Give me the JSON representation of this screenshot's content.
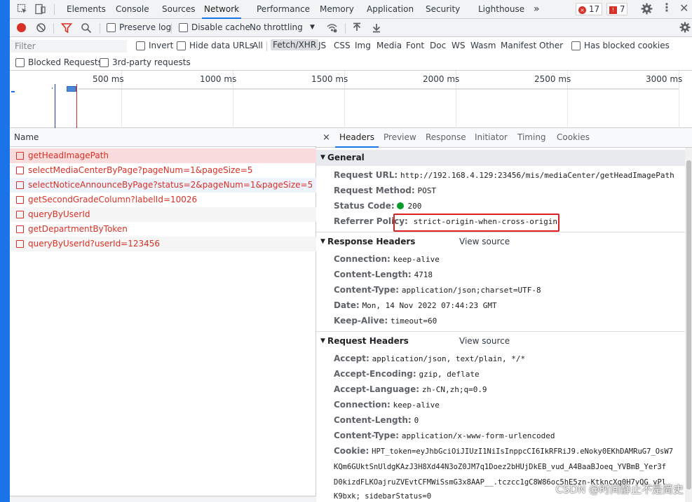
{
  "topbar": {
    "tabs": [
      "Elements",
      "Console",
      "Sources",
      "Network",
      "Performance",
      "Memory",
      "Application",
      "Security",
      "Lighthouse"
    ],
    "more": "»",
    "errors": "17",
    "warnings": "7"
  },
  "toolbar": {
    "preserve_log": "Preserve log",
    "disable_cache": "Disable cache",
    "throttling": "No throttling"
  },
  "filter": {
    "placeholder": "Filter",
    "invert": "Invert",
    "hide_data_urls": "Hide data URLs",
    "types": [
      "All",
      "Fetch/XHR",
      "JS",
      "CSS",
      "Img",
      "Media",
      "Font",
      "Doc",
      "WS",
      "Wasm",
      "Manifest",
      "Other"
    ],
    "selected_type": "Fetch/XHR",
    "has_blocked_cookies": "Has blocked cookies",
    "blocked_requests": "Blocked Requests",
    "third_party": "3rd-party requests"
  },
  "timeline": {
    "ticks": [
      "500 ms",
      "1000 ms",
      "1500 ms",
      "2000 ms",
      "2500 ms",
      "3000 ms"
    ]
  },
  "requests": {
    "header": "Name",
    "items": [
      "getHeadImagePath",
      "selectMediaCenterByPage?pageNum=1&pageSize=5",
      "selectNoticeAnnounceByPage?status=2&pageNum=1&pageSize=5",
      "getSecondGradeColumn?labelId=10026",
      "queryByUserId",
      "getDepartmentByToken",
      "queryByUserId?userId=123456"
    ]
  },
  "details": {
    "close": "×",
    "tabs": [
      "Headers",
      "Preview",
      "Response",
      "Initiator",
      "Timing",
      "Cookies"
    ],
    "general": {
      "title": "General",
      "request_url_k": "Request URL:",
      "request_url_v": "http://192.168.4.129:23456/mis/mediaCenter/getHeadImagePath",
      "method_k": "Request Method:",
      "method_v": "POST",
      "status_k": "Status Code:",
      "status_v": "200",
      "referrer_k": "Referrer Policy:",
      "referrer_v": "strict-origin-when-cross-origin"
    },
    "response_headers": {
      "title": "Response Headers",
      "view_source": "View source",
      "rows": [
        {
          "k": "Connection:",
          "v": "keep-alive"
        },
        {
          "k": "Content-Length:",
          "v": "4718"
        },
        {
          "k": "Content-Type:",
          "v": "application/json;charset=UTF-8"
        },
        {
          "k": "Date:",
          "v": "Mon, 14 Nov 2022 07:44:23 GMT"
        },
        {
          "k": "Keep-Alive:",
          "v": "timeout=60"
        }
      ]
    },
    "request_headers": {
      "title": "Request Headers",
      "view_source": "View source",
      "rows": [
        {
          "k": "Accept:",
          "v": "application/json, text/plain, */*"
        },
        {
          "k": "Accept-Encoding:",
          "v": "gzip, deflate"
        },
        {
          "k": "Accept-Language:",
          "v": "zh-CN,zh;q=0.9"
        },
        {
          "k": "Connection:",
          "v": "keep-alive"
        },
        {
          "k": "Content-Length:",
          "v": "0"
        },
        {
          "k": "Content-Type:",
          "v": "application/x-www-form-urlencoded"
        }
      ],
      "cookie_k": "Cookie:",
      "cookie_lines": [
        "HPT_token=eyJhbGciOiJIUzI1NiIsInppcCI6IkRFRiJ9.eNoky0EKhDAMRuG7_OsW7",
        "KQm6GUktSnUldgKAzJ3H8Xd44N3oZ0JM7q1Doez2bHUjDkEB_vud_A4BaaBJoeq_YVBmB_Yer3f",
        "D0kizdFLKOajruZVEvtCFMWiSsmG3x8AAP__.tczcc1gC8W86oc5hE5zn-KtkncXg0H7yQG_yPl",
        "K9bxk; sidebarStatus=0"
      ]
    }
  },
  "watermark": "CSDN @时间静止不是简史"
}
